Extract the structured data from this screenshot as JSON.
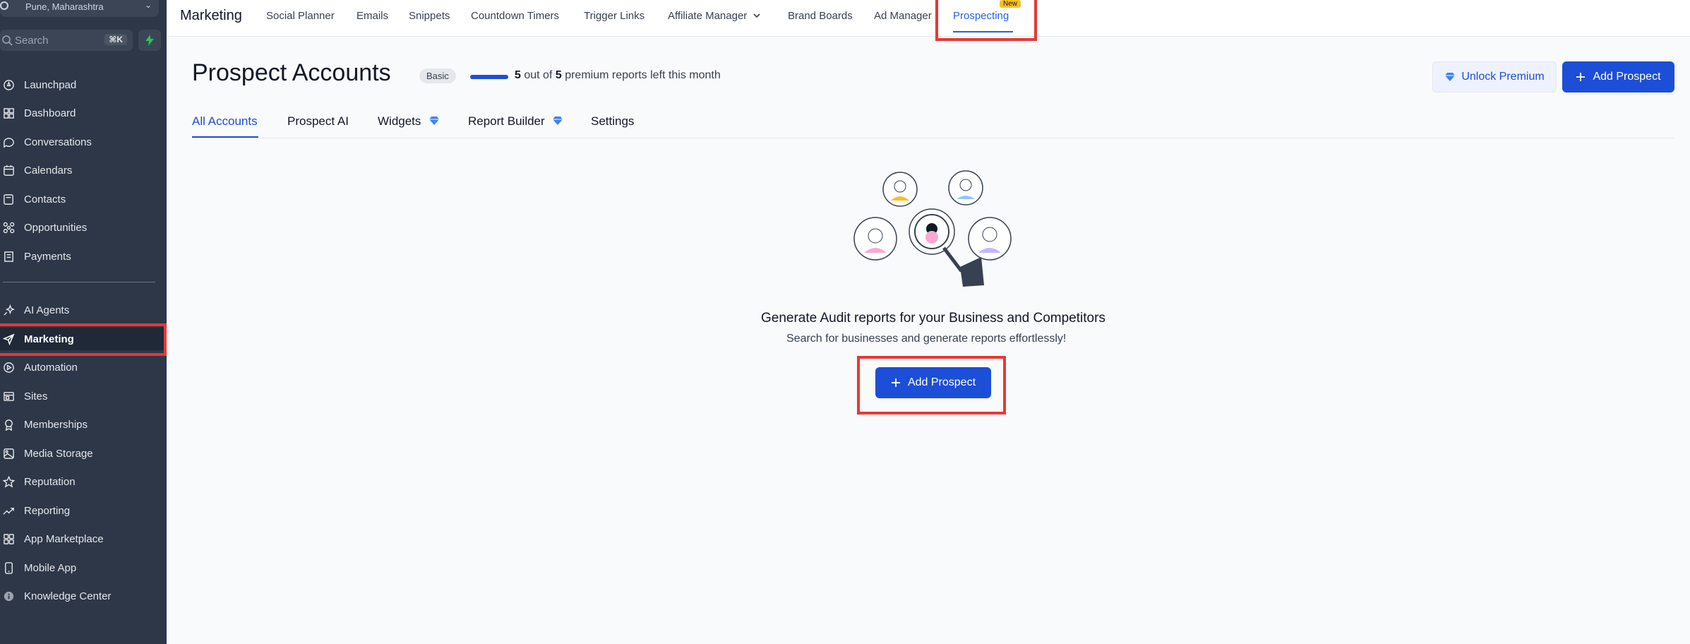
{
  "sidebar": {
    "location_sub": "Pune, Maharashtra",
    "search_placeholder": "Search",
    "search_shortcut": "⌘K",
    "items": [
      {
        "label": "Launchpad",
        "icon": "rocket-icon"
      },
      {
        "label": "Dashboard",
        "icon": "grid-icon"
      },
      {
        "label": "Conversations",
        "icon": "chat-icon"
      },
      {
        "label": "Calendars",
        "icon": "calendar-icon"
      },
      {
        "label": "Contacts",
        "icon": "contacts-icon"
      },
      {
        "label": "Opportunities",
        "icon": "opportunities-icon"
      },
      {
        "label": "Payments",
        "icon": "receipt-icon"
      },
      {
        "label": "AI Agents",
        "icon": "sparkle-icon"
      },
      {
        "label": "Marketing",
        "icon": "send-icon"
      },
      {
        "label": "Automation",
        "icon": "automation-icon"
      },
      {
        "label": "Sites",
        "icon": "sites-icon"
      },
      {
        "label": "Memberships",
        "icon": "badge-icon"
      },
      {
        "label": "Media Storage",
        "icon": "image-icon"
      },
      {
        "label": "Reputation",
        "icon": "star-icon"
      },
      {
        "label": "Reporting",
        "icon": "trend-icon"
      },
      {
        "label": "App Marketplace",
        "icon": "apps-icon"
      },
      {
        "label": "Mobile App",
        "icon": "phone-icon"
      },
      {
        "label": "Knowledge Center",
        "icon": "info-icon"
      }
    ]
  },
  "topbar": {
    "section": "Marketing",
    "tabs": [
      "Social Planner",
      "Emails",
      "Snippets",
      "Countdown Timers",
      "Trigger Links",
      "Affiliate Manager",
      "Brand Boards",
      "Ad Manager",
      "Prospecting"
    ],
    "new_badge": "New"
  },
  "page": {
    "title": "Prospect Accounts",
    "plan_badge": "Basic",
    "quota_used": "5",
    "quota_total": "5",
    "quota_out_of": "out of",
    "quota_suffix": "premium reports left this month",
    "quota_fraction": 1.0,
    "unlock_label": "Unlock Premium",
    "add_prospect_label": "Add Prospect"
  },
  "subtabs": [
    "All Accounts",
    "Prospect AI",
    "Widgets",
    "Report Builder",
    "Settings"
  ],
  "empty_state": {
    "title": "Generate Audit reports for your Business and Competitors",
    "subtitle": "Search for businesses and generate reports effortlessly!",
    "button_label": "Add Prospect"
  },
  "colors": {
    "primary": "#1d4ed8",
    "sidebar_bg": "#2d3748",
    "highlight": "#e53935",
    "new_badge": "#fbbf24"
  }
}
